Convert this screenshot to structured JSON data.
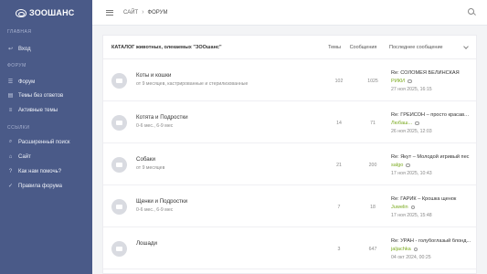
{
  "sidebar": {
    "logo_text": "ЗООШАНС",
    "sections": [
      {
        "title": "ГЛАВНАЯ",
        "items": [
          {
            "icon": "login-icon",
            "glyph": "↩",
            "label": "Вход"
          }
        ]
      },
      {
        "title": "ФОРУМ",
        "items": [
          {
            "icon": "forum-icon",
            "glyph": "☰",
            "label": "Форум"
          },
          {
            "icon": "unanswered-icon",
            "glyph": "▤",
            "label": "Темы без ответов"
          },
          {
            "icon": "active-topics-icon",
            "glyph": "≡",
            "label": "Активные темы"
          }
        ]
      },
      {
        "title": "ССЫЛКИ",
        "items": [
          {
            "icon": "advanced-search-icon",
            "glyph": "⌕",
            "label": "Расширенный поиск"
          },
          {
            "icon": "site-icon",
            "glyph": "⌂",
            "label": "Сайт"
          },
          {
            "icon": "help-icon",
            "glyph": "?",
            "label": "Как нам помочь?"
          },
          {
            "icon": "rules-icon",
            "glyph": "✓",
            "label": "Правила форума"
          }
        ]
      }
    ]
  },
  "topbar": {
    "breadcrumbs": [
      "САЙТ",
      "ФОРУМ"
    ],
    "separator": "›"
  },
  "table": {
    "catalog": "КАТАЛОГ животных, олекаемых \"ЗООшанс\"",
    "col_topics": "Темы",
    "col_posts": "Сообщения",
    "col_last": "Последнее сообщение",
    "rows": [
      {
        "title": "Коты и кошки",
        "sub": "от 9 месяцев, кастрированные и стерилизованные",
        "topics": "102",
        "posts": "1025",
        "last_title": "Re: СОЛОМЕЯ БЕЛИНСКАЯ",
        "last_user": "РИКИ",
        "last_date": "27 ноя 2025, 16:15"
      },
      {
        "title": "Котята и Подростки",
        "sub": "0-6 мес., 6-9 мес",
        "topics": "14",
        "posts": "71",
        "last_title": "Re: ГРЕЙСОН – просто красавчик",
        "last_user": "Любаш...",
        "last_date": "26 ноя 2025, 12:03"
      },
      {
        "title": "Собаки",
        "sub": "от 9 месяцев",
        "topics": "21",
        "posts": "200",
        "last_title": "Re: Якут – Молодой игривый пес",
        "last_user": "salgo",
        "last_date": "17 ноя 2025, 10:43"
      },
      {
        "title": "Щенки и Подростки",
        "sub": "0-6 мес., 6-9 мес",
        "topics": "7",
        "posts": "18",
        "last_title": "Re: ГАРИК – Крошка щенок",
        "last_user": "Juwelin",
        "last_date": "17 ноя 2025, 15:48"
      },
      {
        "title": "Лошади",
        "sub": "",
        "topics": "3",
        "posts": "647",
        "last_title": "Re: УРАН - голубоглазый блонд...",
        "last_user": "jaljachka",
        "last_date": "04 окт 2024, 00:25"
      }
    ]
  }
}
